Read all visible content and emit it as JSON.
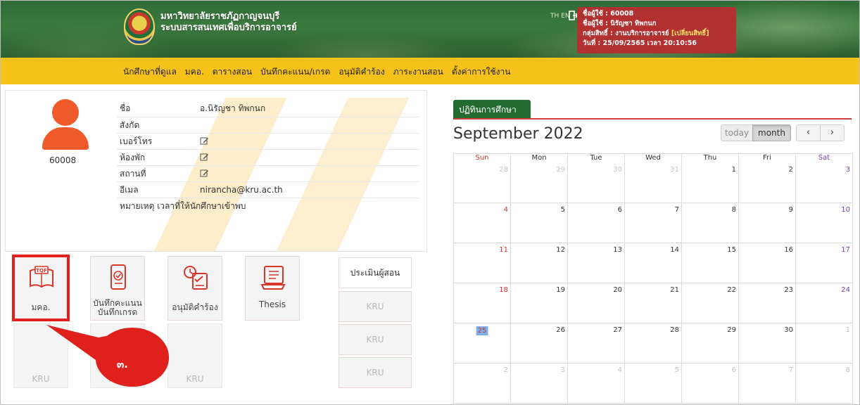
{
  "header": {
    "university_name": "มหาวิทยาลัยราชภัฏกาญจนบุรี",
    "system_name": "ระบบสารสนเทศเพื่อบริการอาจารย์",
    "lang_toggle": "TH EN",
    "user_box": {
      "username_line": "ชื่อผู้ใช้ : 60008",
      "name_line": "ชื่อผู้ใช้ : นิรัญชา ทิพกนก",
      "group_line": "กลุ่มสิทธิ์ : งานบริการอาจารย์",
      "change_role": "[เปลี่ยนสิทธิ์]",
      "date_line": "วันที่ : 25/09/2565 เวลา 20:10:56"
    }
  },
  "nav": {
    "items": [
      {
        "label": "นักศึกษาที่ดูแล"
      },
      {
        "label": "มคอ."
      },
      {
        "label": "ตารางสอน"
      },
      {
        "label": "บันทึกคะแนน/เกรด"
      },
      {
        "label": "อนุมัติคำร้อง"
      },
      {
        "label": "ภาระงานสอน"
      },
      {
        "label": "ตั้งค่าการใช้งาน"
      }
    ]
  },
  "profile": {
    "user_id": "60008",
    "fields": [
      {
        "label": "ชื่อ",
        "value": "อ.นิรัญชา ทิพกนก",
        "editable": false
      },
      {
        "label": "สังกัด",
        "value": "",
        "editable": false
      },
      {
        "label": "เบอร์โทร",
        "value": "",
        "editable": true
      },
      {
        "label": "ห้องพัก",
        "value": "",
        "editable": true
      },
      {
        "label": "สถานที่",
        "value": "",
        "editable": true
      },
      {
        "label": "อีเมล",
        "value": "nirancha@kru.ac.th",
        "editable": false
      }
    ],
    "note": "หมายเหตุ เวลาที่ให้นักศึกษาเข้าพบ"
  },
  "tiles": {
    "tqf": {
      "label": "มคอ.",
      "icon": "tqf-book-icon"
    },
    "grades": {
      "label_line1": "บันทึกคะแนน",
      "label_line2": "บันทึกเกรด",
      "icon": "tablet-grade-icon"
    },
    "approve": {
      "label": "อนุมัติคำร้อง",
      "icon": "approve-request-icon"
    },
    "thesis": {
      "label": "Thesis",
      "icon": "thesis-book-icon"
    },
    "empty_label": "KRU"
  },
  "side_buttons": {
    "evaluate": "ประเมินผู้สอน",
    "kru": "KRU"
  },
  "callout": {
    "label": "๓."
  },
  "calendar": {
    "tab_label": "ปฏิทินการศึกษา",
    "title": "September 2022",
    "today_btn": "today",
    "month_btn": "month",
    "prev_btn": "‹",
    "next_btn": "›",
    "weekdays": [
      "Sun",
      "Mon",
      "Tue",
      "Wed",
      "Thu",
      "Fri",
      "Sat"
    ],
    "weeks": [
      [
        "28",
        "29",
        "30",
        "31",
        "1",
        "2",
        "3"
      ],
      [
        "4",
        "5",
        "6",
        "7",
        "8",
        "9",
        "10"
      ],
      [
        "11",
        "12",
        "13",
        "14",
        "15",
        "16",
        "17"
      ],
      [
        "18",
        "19",
        "20",
        "21",
        "22",
        "23",
        "24"
      ],
      [
        "25",
        "26",
        "27",
        "28",
        "29",
        "30",
        "1"
      ],
      [
        "2",
        "3",
        "4",
        "5",
        "6",
        "7",
        "8"
      ]
    ],
    "today": "25"
  },
  "colors": {
    "header_green": "#2f6a37",
    "nav_yellow": "#f6c21a",
    "user_box_red": "#b0312f",
    "avatar_orange": "#ef5a2a",
    "tab_green": "#246b32",
    "highlight_red": "#e0201c"
  }
}
